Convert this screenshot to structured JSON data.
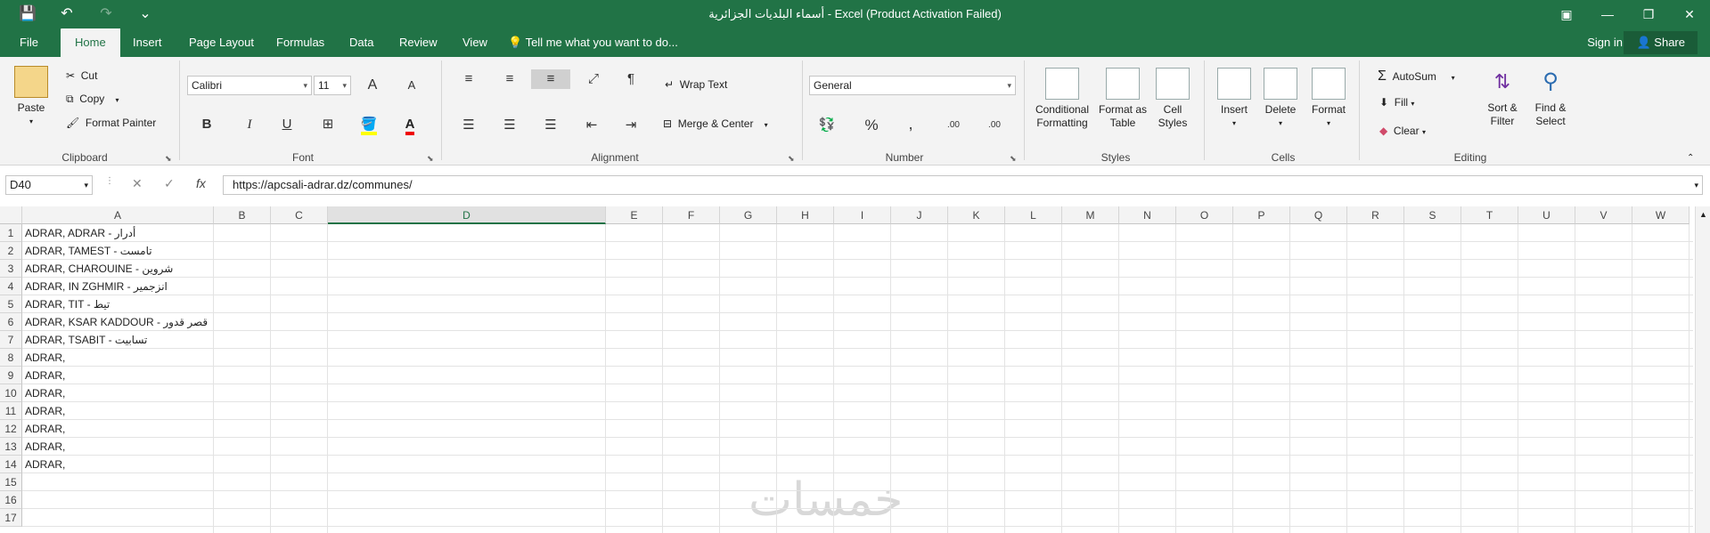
{
  "window": {
    "title": "أسماء البلديات الجزائرية - Excel (Product Activation Failed)",
    "qat": {
      "save_icon": "💾",
      "undo_icon": "↶",
      "redo_icon": "↷",
      "customize_icon": "⌄"
    },
    "controls": {
      "ribbon_options": "▣",
      "minimize": "—",
      "restore": "❐",
      "close": "✕"
    }
  },
  "tabs": [
    "File",
    "Home",
    "Insert",
    "Page Layout",
    "Formulas",
    "Data",
    "Review",
    "View"
  ],
  "active_tab": "Home",
  "tell_me": "Tell me what you want to do...",
  "sign_in": "Sign in",
  "share": "Share",
  "ribbon": {
    "clipboard": {
      "label": "Clipboard",
      "paste": "Paste",
      "cut": "Cut",
      "copy": "Copy",
      "format_painter": "Format Painter"
    },
    "font": {
      "label": "Font",
      "name": "Calibri",
      "size": "11",
      "bold": "B",
      "italic": "I",
      "underline": "U",
      "grow": "A",
      "shrink": "A"
    },
    "alignment": {
      "label": "Alignment",
      "wrap_text": "Wrap Text",
      "merge_center": "Merge & Center"
    },
    "number": {
      "label": "Number",
      "format": "General",
      "percent": "%",
      "comma": ",",
      "inc_decimal": ".00",
      "dec_decimal": ".00"
    },
    "styles": {
      "label": "Styles",
      "conditional": [
        "Conditional",
        "Formatting"
      ],
      "format_table": [
        "Format as",
        "Table"
      ],
      "cell_styles": [
        "Cell",
        "Styles"
      ]
    },
    "cells": {
      "label": "Cells",
      "insert": "Insert",
      "delete": "Delete",
      "format": "Format"
    },
    "editing": {
      "label": "Editing",
      "autosum": "AutoSum",
      "fill": "Fill",
      "clear": "Clear",
      "sort_filter": [
        "Sort &",
        "Filter"
      ],
      "find_select": [
        "Find &",
        "Select"
      ]
    }
  },
  "formula_bar": {
    "name_box": "D40",
    "fx": "fx",
    "content": "https://apcsali-adrar.dz/communes/"
  },
  "columns": [
    "A",
    "B",
    "C",
    "D",
    "E",
    "F",
    "G",
    "H",
    "I",
    "J",
    "K",
    "L",
    "M",
    "N",
    "O",
    "P",
    "Q",
    "R",
    "S",
    "T",
    "U",
    "V",
    "W"
  ],
  "selected_column": "D",
  "rows": [
    "1",
    "2",
    "3",
    "4",
    "5",
    "6",
    "7",
    "8",
    "9",
    "10",
    "11",
    "12",
    "13",
    "14",
    "15",
    "16",
    "17"
  ],
  "cells_a": [
    "ADRAR, ADRAR - أدرار",
    "ADRAR, TAMEST - تامست",
    "ADRAR, CHAROUINE - شروين",
    "ADRAR, IN ZGHMIR - انزجمير",
    "ADRAR, TIT - تيط",
    "ADRAR, KSAR KADDOUR - قصر قدور",
    "ADRAR, TSABIT - تسابيت",
    "ADRAR,",
    "ADRAR,",
    "ADRAR,",
    "ADRAR,",
    "ADRAR,",
    "ADRAR,",
    "ADRAR,"
  ],
  "watermark": "خمسات"
}
